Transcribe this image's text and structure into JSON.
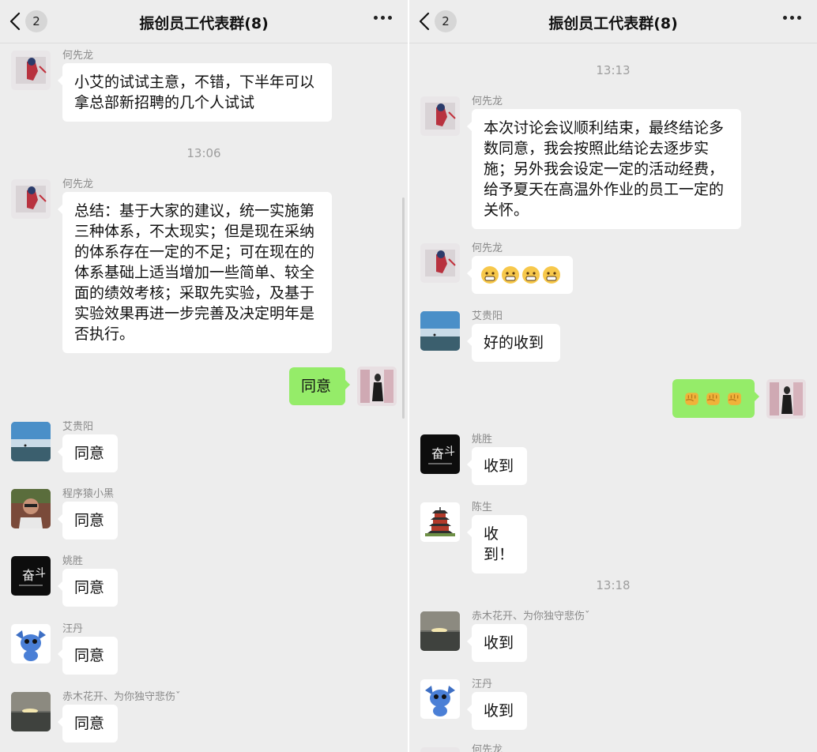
{
  "left": {
    "header": {
      "back_count": "2",
      "title": "振创员工代表群(8)"
    },
    "timestamps": [
      "13:06"
    ],
    "messages": [
      {
        "sender": "何先龙",
        "text": "小艾的试试主意，不错，下半年可以拿总部新招聘的几个人试试"
      },
      {
        "sender": "何先龙",
        "text": "总结：基于大家的建议，统一实施第三种体系，不太现实；但是现在采纳的体系存在一定的不足；可在现在的体系基础上适当增加一些简单、较全面的绩效考核；采取先实验，及基于实验效果再进一步完善及决定明年是否执行。"
      },
      {
        "sender": "",
        "text": "同意"
      },
      {
        "sender": "艾贵阳",
        "text": "同意"
      },
      {
        "sender": "程序猿小黑",
        "text": "同意"
      },
      {
        "sender": "姚胜",
        "text": "同意"
      },
      {
        "sender": "汪丹",
        "text": "同意"
      },
      {
        "sender": "赤木花开、为你独守悲伤ˇ",
        "text": "同意"
      }
    ]
  },
  "right": {
    "header": {
      "back_count": "2",
      "title": "振创员工代表群(8)"
    },
    "timestamps": [
      "13:13",
      "13:18"
    ],
    "messages": [
      {
        "sender": "何先龙",
        "text": "本次讨论会议顺利结束，最终结论多数同意，我会按照此结论去逐步实施；另外我会设定一定的活动经费，给予夏天在高温外作业的员工一定的关怀。"
      },
      {
        "sender": "何先龙",
        "emoji": "grimace-emoji",
        "emoji_count": 4
      },
      {
        "sender": "艾贵阳",
        "text": "好的收到"
      },
      {
        "sender": "",
        "emoji": "fist-emoji",
        "emoji_count": 3
      },
      {
        "sender": "姚胜",
        "text": "收到"
      },
      {
        "sender": "陈生",
        "text": "收到！"
      },
      {
        "sender": "赤木花开、为你独守悲伤ˇ",
        "text": "收到"
      },
      {
        "sender": "汪丹",
        "text": "收到"
      },
      {
        "sender": "何先龙",
        "text": ""
      }
    ]
  },
  "avatar_art": {
    "fendou_lines": [
      "奋",
      "斗"
    ]
  },
  "colors": {
    "background": "#ededed",
    "bubble_other": "#ffffff",
    "bubble_mine": "#95ec69",
    "timestamp": "#9e9e9e",
    "sender_name": "#8a8a8a"
  }
}
